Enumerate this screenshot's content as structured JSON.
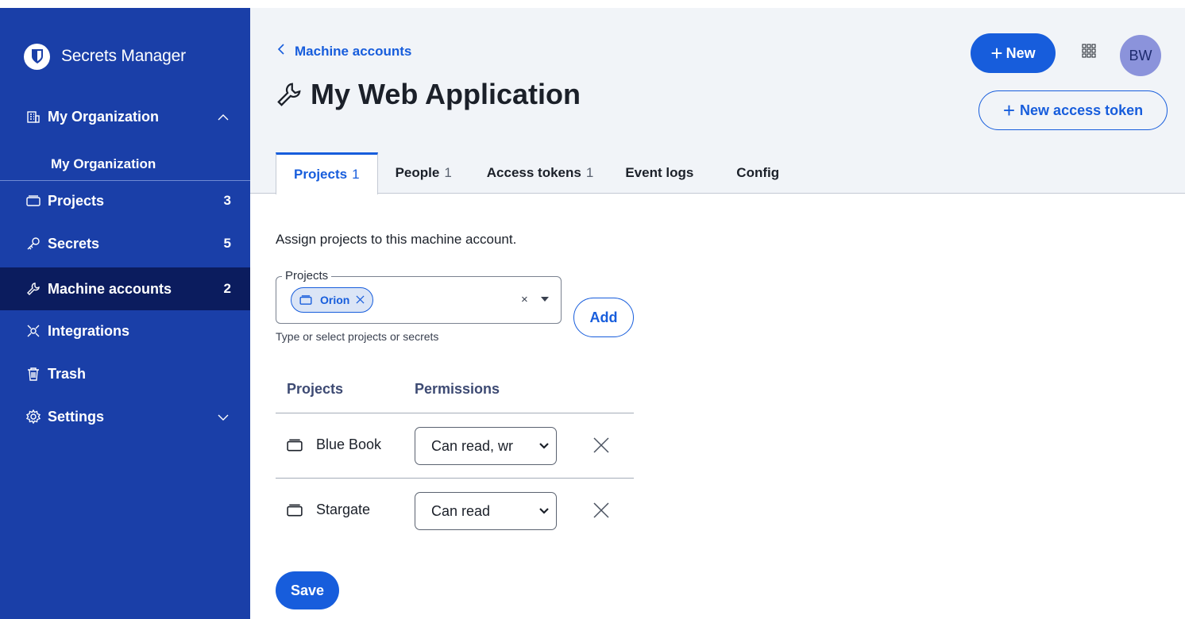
{
  "sidebar": {
    "brand": "Secrets Manager",
    "org": {
      "label": "My Organization",
      "sub_label": "My Organization"
    },
    "items": [
      {
        "label": "Projects",
        "count": "3"
      },
      {
        "label": "Secrets",
        "count": "5"
      },
      {
        "label": "Machine accounts",
        "count": "2"
      },
      {
        "label": "Integrations"
      },
      {
        "label": "Trash"
      },
      {
        "label": "Settings"
      }
    ]
  },
  "header": {
    "back_label": "Machine accounts",
    "title": "My Web Application",
    "new_label": "New",
    "avatar_initials": "BW",
    "new_token_label": "New access token"
  },
  "tabs": [
    {
      "label": "Projects",
      "count": "1"
    },
    {
      "label": "People",
      "count": "1"
    },
    {
      "label": "Access tokens",
      "count": "1"
    },
    {
      "label": "Event logs"
    },
    {
      "label": "Config"
    }
  ],
  "main": {
    "description": "Assign projects to this machine account.",
    "field_label": "Projects",
    "chip_label": "Orion",
    "clear_symbol": "×",
    "add_label": "Add",
    "hint": "Type or select projects or secrets",
    "columns": [
      "Projects",
      "Permissions"
    ],
    "rows": [
      {
        "name": "Blue Book",
        "permission": "Can read, wr"
      },
      {
        "name": "Stargate",
        "permission": "Can read"
      }
    ],
    "save_label": "Save"
  },
  "colors": {
    "sidebar": "#1a3fa8",
    "sidebar_active": "#0b1c5e",
    "accent": "#175ddc",
    "header_bg": "#f1f4f8"
  }
}
